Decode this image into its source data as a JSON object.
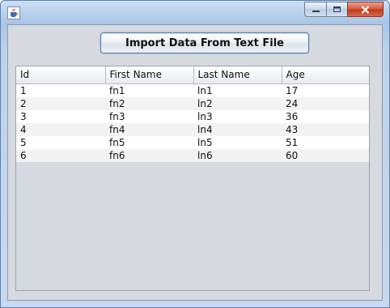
{
  "window": {
    "app_icon": "java-cup-icon",
    "controls": {
      "minimize_icon": "minimize-icon",
      "maximize_icon": "maximize-icon",
      "close_icon": "close-icon"
    }
  },
  "toolbar": {
    "import_label": "Import Data From Text File"
  },
  "table": {
    "columns": [
      "Id",
      "First Name",
      "Last Name",
      "Age"
    ],
    "rows": [
      [
        "1",
        "fn1",
        "ln1",
        "17"
      ],
      [
        "2",
        "fn2",
        "ln2",
        "24"
      ],
      [
        "3",
        "fn3",
        "ln3",
        "36"
      ],
      [
        "4",
        "fn4",
        "ln4",
        "43"
      ],
      [
        "5",
        "fn5",
        "ln5",
        "51"
      ],
      [
        "6",
        "fn6",
        "ln6",
        "60"
      ]
    ]
  },
  "colors": {
    "close_button": "#c23516",
    "client_background": "#d6d9df",
    "row_alt": "#f2f2f2"
  }
}
